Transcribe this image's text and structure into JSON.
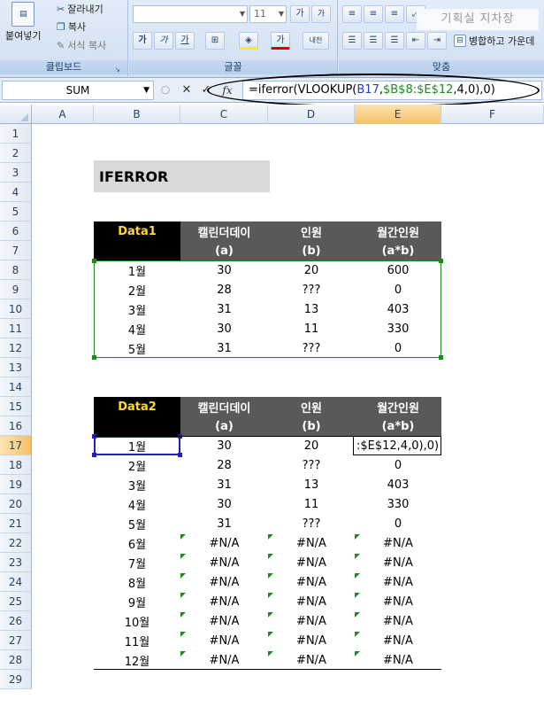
{
  "ribbon": {
    "clipboard": {
      "paste_label": "붙여넣기",
      "cut_label": "잘라내기",
      "copy_label": "복사",
      "format_painter_label": "서식 복사",
      "group_label": "클립보드"
    },
    "font": {
      "font_name": "",
      "font_size": "11",
      "group_label": "글꼴",
      "grow_label": "가",
      "shrink_label": "가",
      "bold_label": "가",
      "italic_label": "가",
      "underline_label": "가",
      "fill_label": "가",
      "font_color_label": "가",
      "phonetic_label": "내천"
    },
    "alignment": {
      "merge_label": "병합하고 가운데",
      "group_label": "맞춤",
      "watermark": "기획실 지차장"
    }
  },
  "formula_bar": {
    "name_box": "SUM",
    "cancel_label": "✕",
    "enter_label": "✓",
    "fx_label": "fx",
    "formula": {
      "prefix": "=iferror(VLOOKUP(",
      "ref1": "B17",
      "sep1": ",",
      "ref2": "$B$8:$E$12",
      "suffix": ",4,0),0)"
    }
  },
  "grid": {
    "columns": [
      "A",
      "B",
      "C",
      "D",
      "E",
      "F"
    ],
    "active_column": "E",
    "rows": [
      "1",
      "2",
      "3",
      "4",
      "5",
      "6",
      "7",
      "8",
      "9",
      "10",
      "11",
      "12",
      "13",
      "14",
      "15",
      "16",
      "17",
      "18",
      "19",
      "20",
      "21",
      "22",
      "23",
      "24",
      "25",
      "26",
      "27",
      "28",
      "29"
    ],
    "active_row": "17",
    "title": "IFERROR",
    "table1": {
      "header_row1": [
        "Data1",
        "캘린더데이",
        "인원",
        "월간인원"
      ],
      "header_row2": [
        "",
        "(a)",
        "(b)",
        "(a*b)"
      ],
      "rows": [
        [
          "1월",
          "30",
          "20",
          "600"
        ],
        [
          "2월",
          "28",
          "???",
          "0"
        ],
        [
          "3월",
          "31",
          "13",
          "403"
        ],
        [
          "4월",
          "30",
          "11",
          "330"
        ],
        [
          "5월",
          "31",
          "???",
          "0"
        ]
      ]
    },
    "table2": {
      "header_row1": [
        "Data2",
        "캘린더데이",
        "인원",
        "월간인원"
      ],
      "header_row2": [
        "",
        "(a)",
        "(b)",
        "(a*b)"
      ],
      "editing_text": ":$E$12,4,0),0)",
      "rows": [
        [
          "1월",
          "30",
          "20",
          ""
        ],
        [
          "2월",
          "28",
          "???",
          "0"
        ],
        [
          "3월",
          "31",
          "13",
          "403"
        ],
        [
          "4월",
          "30",
          "11",
          "330"
        ],
        [
          "5월",
          "31",
          "???",
          "0"
        ],
        [
          "6월",
          "#N/A",
          "#N/A",
          "#N/A"
        ],
        [
          "7월",
          "#N/A",
          "#N/A",
          "#N/A"
        ],
        [
          "8월",
          "#N/A",
          "#N/A",
          "#N/A"
        ],
        [
          "9월",
          "#N/A",
          "#N/A",
          "#N/A"
        ],
        [
          "10월",
          "#N/A",
          "#N/A",
          "#N/A"
        ],
        [
          "11월",
          "#N/A",
          "#N/A",
          "#N/A"
        ],
        [
          "12월",
          "#N/A",
          "#N/A",
          "#N/A"
        ]
      ]
    }
  }
}
